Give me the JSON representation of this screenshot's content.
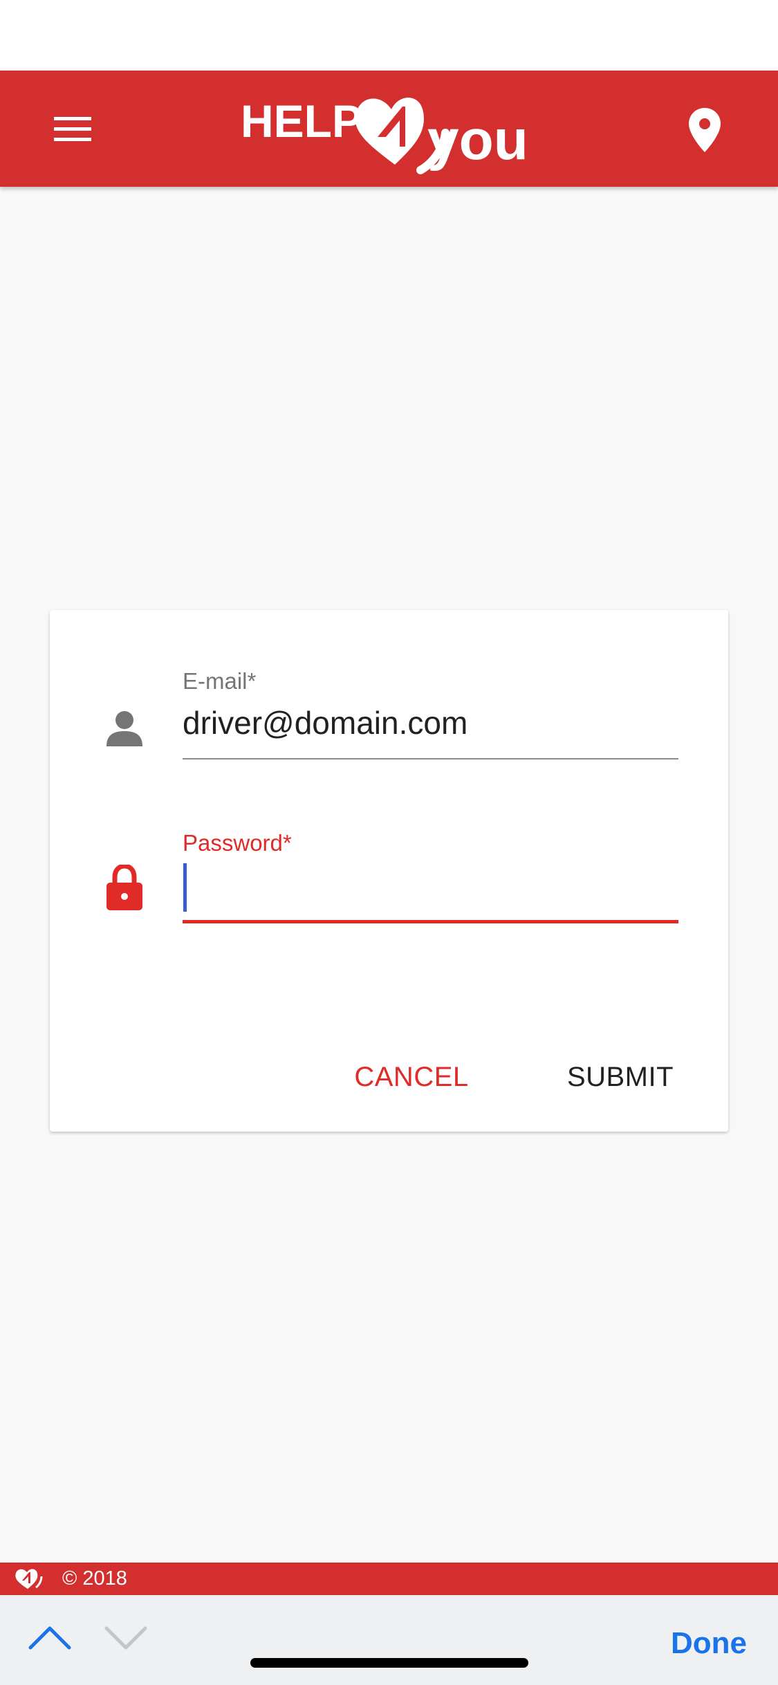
{
  "app": {
    "logo_text": "HELP 4 you",
    "colors": {
      "brand": "#d32f2f",
      "accent_error": "#e02b27",
      "link": "#1a73e8"
    },
    "header": {
      "menu_icon": "hamburger-menu-icon",
      "location_icon": "location-pin-icon"
    }
  },
  "login_form": {
    "email": {
      "label": "E-mail*",
      "value": "driver@domain.com",
      "icon": "person-icon"
    },
    "password": {
      "label": "Password*",
      "value": "",
      "icon": "lock-icon"
    },
    "cancel_label": "CANCEL",
    "submit_label": "SUBMIT"
  },
  "footer": {
    "copyright": "© 2018",
    "icon": "help4you-mini-logo-icon"
  },
  "keyboard_toolbar": {
    "prev_icon": "chevron-up-icon",
    "next_icon": "chevron-down-icon",
    "done_label": "Done"
  }
}
